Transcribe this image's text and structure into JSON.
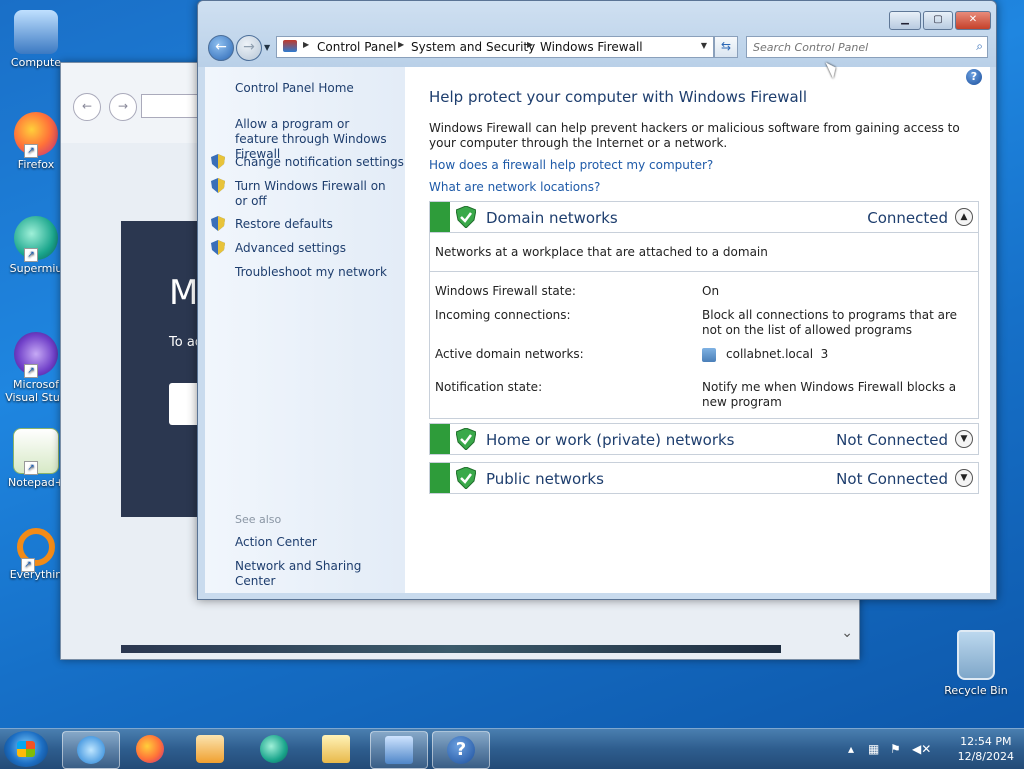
{
  "desktop": {
    "icons": [
      {
        "label": "Compute"
      },
      {
        "label": "Firefox"
      },
      {
        "label": "Supermiu"
      },
      {
        "label": "Microsof\nVisual Stud"
      },
      {
        "label": "Notepad+"
      },
      {
        "label": "Everythin"
      }
    ],
    "recycle_bin": "Recycle Bin"
  },
  "background_window": {
    "banner_big": "M",
    "banner_small": "To ac"
  },
  "window": {
    "breadcrumb": [
      "Control Panel",
      "System and Security",
      "Windows Firewall"
    ],
    "search_placeholder": "Search Control Panel",
    "left_pane": {
      "home": "Control Panel Home",
      "links": [
        "Allow a program or feature through Windows Firewall",
        "Change notification settings",
        "Turn Windows Firewall on or off",
        "Restore defaults",
        "Advanced settings",
        "Troubleshoot my network"
      ],
      "see_also_label": "See also",
      "see_also": [
        "Action Center",
        "Network and Sharing Center"
      ]
    },
    "main": {
      "title": "Help protect your computer with Windows Firewall",
      "intro": "Windows Firewall can help prevent hackers or malicious software from gaining access to your computer through the Internet or a network.",
      "link1": "How does a firewall help protect my computer?",
      "link2": "What are network locations?",
      "domain": {
        "name": "Domain networks",
        "state": "Connected",
        "description": "Networks at a workplace that are attached to a domain",
        "rows": [
          {
            "label": "Windows Firewall state:",
            "value": "On"
          },
          {
            "label": "Incoming connections:",
            "value": "Block all connections to programs that are not on the list of allowed programs"
          },
          {
            "label": "Active domain networks:",
            "value": "collabnet.local  3"
          },
          {
            "label": "Notification state:",
            "value": "Notify me when Windows Firewall blocks a new program"
          }
        ]
      },
      "private": {
        "name": "Home or work (private) networks",
        "state": "Not Connected"
      },
      "public": {
        "name": "Public networks",
        "state": "Not Connected"
      }
    },
    "help_glyph": "?"
  },
  "taskbar": {
    "clock_time": "12:54 PM",
    "clock_date": "12/8/2024"
  },
  "colors": {
    "firewall_green": "#2e9c3a",
    "link_blue": "#1e5aa8",
    "heading_blue": "#1e3e6e"
  }
}
